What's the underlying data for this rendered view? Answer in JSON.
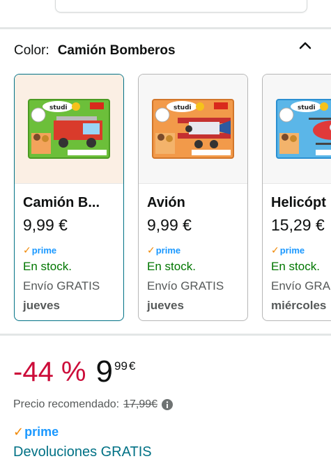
{
  "variation": {
    "label": "Color:",
    "selected_value": "Camión Bomberos"
  },
  "cards": [
    {
      "title": "Camión B...",
      "price": "9,99 €",
      "prime": "prime",
      "stock": "En stock.",
      "shipping": "Envío GRATIS",
      "day": "jueves",
      "image_desc": "fire-truck-puzzle-box",
      "accent": "#d93b2b"
    },
    {
      "title": "Avión",
      "price": "9,99 €",
      "prime": "prime",
      "stock": "En stock.",
      "shipping": "Envío GRATIS",
      "day": "jueves",
      "image_desc": "airplane-puzzle-box",
      "accent": "#e8742a"
    },
    {
      "title": "Helicópt",
      "price": "15,29 €",
      "prime": "prime",
      "stock": "En stock.",
      "shipping": "Envío GRA",
      "day": "miércoles",
      "image_desc": "helicopter-puzzle-box",
      "accent": "#2a8fd1"
    }
  ],
  "price": {
    "discount": "-44 %",
    "whole": "9",
    "fraction": "99",
    "currency": "€"
  },
  "rrp": {
    "label": "Precio recomendado:",
    "value": "17,99€"
  },
  "prime_badge": "prime",
  "returns": "Devoluciones GRATIS",
  "colors": {
    "link": "#007185",
    "prime_blue": "#1a98ff",
    "prime_check": "#f08804",
    "discount_red": "#cc0c39",
    "stock_green": "#007600"
  }
}
